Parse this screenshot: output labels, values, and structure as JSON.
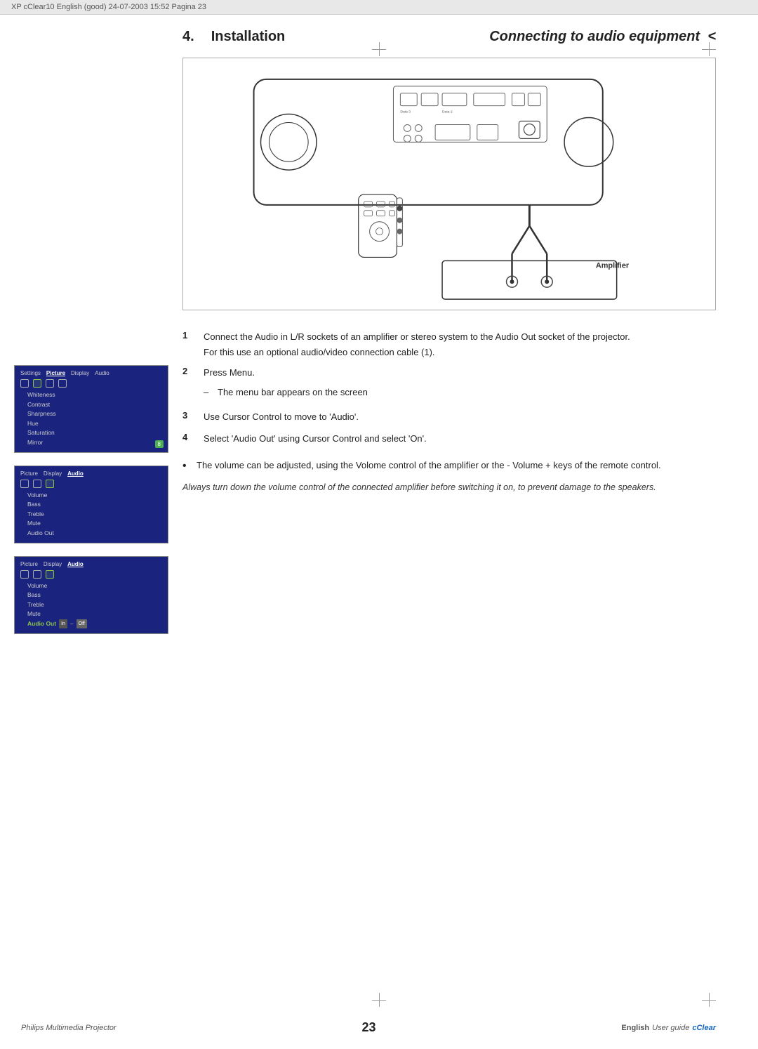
{
  "header": {
    "text": "XP cClear10 English (good) 24-07-2003 15:52 Pagina 23"
  },
  "page": {
    "section_number": "4.",
    "section_main_title": "Installation",
    "section_sub_title": "Connecting to audio equipment",
    "section_sub_arrow": "<"
  },
  "diagram": {
    "amplifier_label": "Amplifier"
  },
  "steps": [
    {
      "number": "1",
      "text": "Connect the Audio in L/R sockets of an amplifier or stereo system to the Audio Out socket of the projector.",
      "sub": "For this use an optional audio/video connection cable (1)."
    },
    {
      "number": "2",
      "text": "Press Menu."
    },
    {
      "number": "3",
      "text": "Use Cursor Control to move to 'Audio'."
    },
    {
      "number": "4",
      "text": "Select 'Audio Out' using Cursor Control and select 'On'."
    }
  ],
  "dash_note": "The menu bar appears on the screen",
  "bullet_note": "The volume can be adjusted, using the Volome control of the amplifier or the - Volume + keys of the remote control.",
  "italic_warning": "Always turn down the volume control of the connected amplifier before switching it on, to prevent damage to the speakers.",
  "screens": [
    {
      "tabs": [
        "Settings",
        "Picture",
        "Display",
        "Audio"
      ],
      "active_tab": "Picture",
      "icon_count": 4,
      "menu_items": [
        "Whiteness",
        "Contrast",
        "Sharpness",
        "Hue",
        "Saturation",
        "Mirror"
      ],
      "active_item": "",
      "badge": "8"
    },
    {
      "tabs": [
        "Picture",
        "Display",
        "Audio"
      ],
      "active_tab": "Audio",
      "icon_count": 3,
      "menu_items": [
        "Volume",
        "Bass",
        "Treble",
        "Mute",
        "Audio Out"
      ],
      "active_item": ""
    },
    {
      "tabs": [
        "Picture",
        "Display",
        "Audio"
      ],
      "active_tab": "Audio",
      "icon_count": 3,
      "menu_items": [
        "Volume",
        "Bass",
        "Treble",
        "Mute",
        "Audio Out"
      ],
      "active_item": "Audio Out",
      "options": [
        "In",
        "Off"
      ]
    }
  ],
  "footer": {
    "brand": "Philips Multimedia Projector",
    "page_number": "23",
    "language": "English",
    "guide_text": "User guide",
    "product": "cClear"
  }
}
